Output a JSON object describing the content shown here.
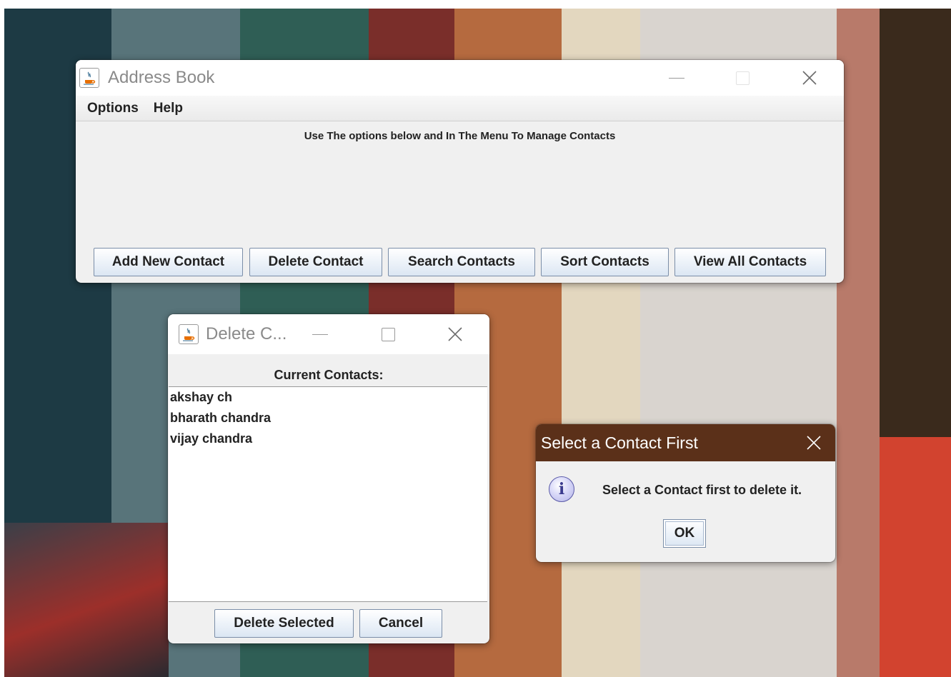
{
  "address_book": {
    "title": "Address Book",
    "menu": [
      "Options",
      "Help"
    ],
    "instructions": "Use The options below and In The Menu To Manage Contacts",
    "buttons": {
      "add": "Add New Contact",
      "delete": "Delete Contact",
      "search": "Search Contacts",
      "sort": "Sort Contacts",
      "view_all": "View All Contacts"
    }
  },
  "delete_window": {
    "title": "Delete C...",
    "section_label": "Current Contacts:",
    "contacts": [
      "akshay ch",
      "bharath chandra",
      "vijay chandra"
    ],
    "buttons": {
      "delete_selected": "Delete Selected",
      "cancel": "Cancel"
    }
  },
  "message_dialog": {
    "title": "Select a Contact First",
    "message": "Select a Contact first to delete it.",
    "ok": "OK",
    "icon": "information-icon"
  },
  "colors": {
    "dialog_titlebar": "#5b3019",
    "button_gradient_bottom": "#dbe6f3",
    "window_background": "#f0f0f0"
  }
}
